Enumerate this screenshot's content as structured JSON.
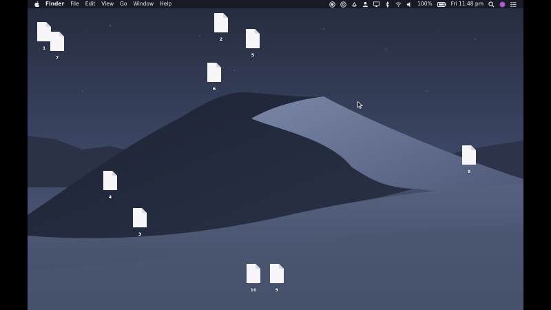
{
  "menubar": {
    "app_name": "Finder",
    "menus": [
      "File",
      "Edit",
      "View",
      "Go",
      "Window",
      "Help"
    ],
    "battery": "100%",
    "clock": "Fri 11:48 pm"
  },
  "desktop": {
    "files": [
      {
        "label": "1"
      },
      {
        "label": "7"
      },
      {
        "label": "2"
      },
      {
        "label": "5"
      },
      {
        "label": "6"
      },
      {
        "label": "8"
      },
      {
        "label": "4"
      },
      {
        "label": "3"
      },
      {
        "label": "10"
      },
      {
        "label": "9"
      }
    ]
  },
  "colors": {
    "sky_top": "#2d3448",
    "dune_shadow": "#1c2233",
    "dune_light": "#6a7796"
  }
}
